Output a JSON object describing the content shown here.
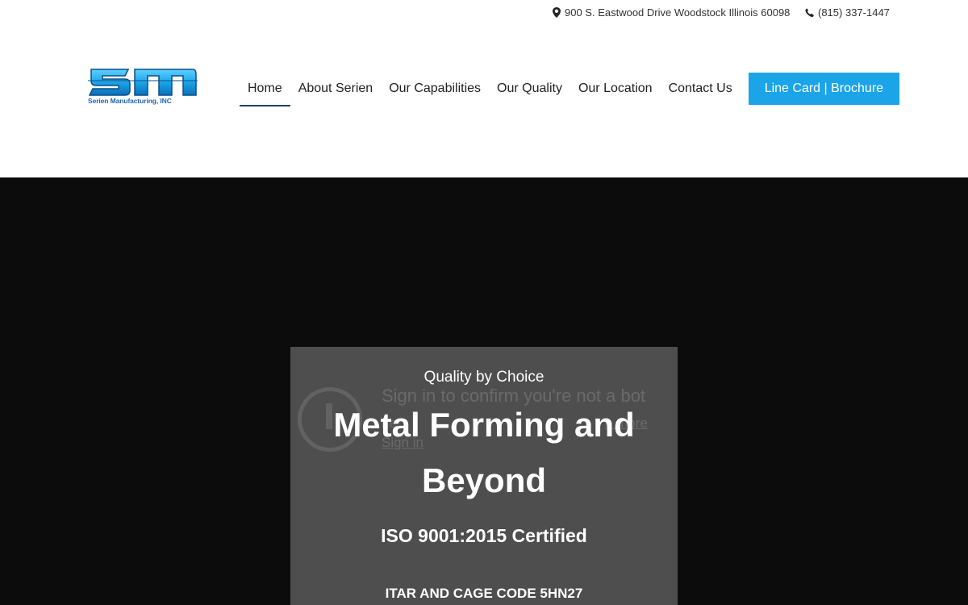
{
  "topbar": {
    "address": "900 S. Eastwood Drive Woodstock Illinois 60098",
    "phone": "(815) 337-1447",
    "address_icon": "map-pin-icon",
    "phone_icon": "phone-icon"
  },
  "logo": {
    "text": "Serien Manufacturing, INC",
    "color": "#1ba5e8"
  },
  "nav": {
    "items": [
      {
        "label": "Home",
        "active": true
      },
      {
        "label": "About Serien"
      },
      {
        "label": "Our Capabilities"
      },
      {
        "label": "Our Quality"
      },
      {
        "label": "Our Location"
      },
      {
        "label": "Contact Us"
      }
    ],
    "cta_label": "Line Card | Brochure",
    "cta_color": "#1ba5e8"
  },
  "hero": {
    "tagline": "Quality by Choice",
    "headline": "Metal Forming and Beyond",
    "iso": "ISO 9001:2015 Certified",
    "itar": "ITAR AND CAGE CODE 5HN27",
    "video_overlay": {
      "title": "Sign in to confirm you're not a bot",
      "line_partial": "he",
      "learn_more": "n more",
      "sign_in": "Sign in"
    }
  }
}
